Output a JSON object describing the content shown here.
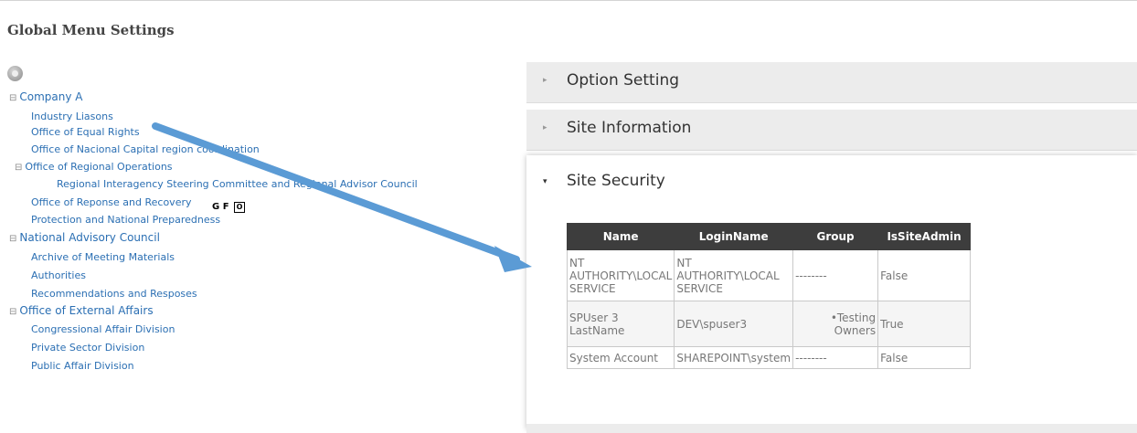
{
  "page": {
    "title": "Global Menu Settings"
  },
  "tree": {
    "icon": "gear-icon",
    "nodes": [
      {
        "label": "Company A",
        "toggle": "⊟",
        "level": 0
      },
      {
        "label": "Industry Liasons",
        "level": 1
      },
      {
        "label": "Office of Equal Rights",
        "level": 1
      },
      {
        "label": "Office of Nacional Capital region coordination",
        "level": 1
      },
      {
        "label": "Office of Regional Operations",
        "toggle": "⊟",
        "level": 1
      },
      {
        "label": "Regional Interagency Steering Committee and Regional Advisor Council",
        "level": 2
      },
      {
        "label": "Office of Reponse and Recovery",
        "level": 1
      },
      {
        "label": "Protection and National Preparedness",
        "level": 1
      },
      {
        "label": "National Advisory Council",
        "toggle": "⊟",
        "level": 0
      },
      {
        "label": "Archive of Meeting Materials",
        "level": 1
      },
      {
        "label": "Authorities",
        "level": 1
      },
      {
        "label": "Recommendations and Resposes",
        "level": 1
      },
      {
        "label": "Office of External Affairs",
        "toggle": "⊟",
        "level": 0
      },
      {
        "label": "Congressional Affair Division",
        "level": 1
      },
      {
        "label": "Private Sector Division",
        "level": 1
      },
      {
        "label": "Public Affair Division",
        "level": 1
      }
    ],
    "controls": {
      "g": "G",
      "f": "F",
      "o": "O"
    }
  },
  "accordion": {
    "option_setting": "Option Setting",
    "site_information": "Site Information",
    "site_security": "Site Security"
  },
  "security_table": {
    "headers": [
      "Name",
      "LoginName",
      "Group",
      "IsSiteAdmin"
    ],
    "rows": [
      {
        "name": "NT AUTHORITY\\LOCAL SERVICE",
        "login": "NT AUTHORITY\\LOCAL SERVICE",
        "group": "--------",
        "admin": "False"
      },
      {
        "name": "SPUser 3 LastName",
        "login": "DEV\\spuser3",
        "group": "Testing Owners",
        "admin": "True"
      },
      {
        "name": "System Account",
        "login": "SHAREPOINT\\system",
        "group": "--------",
        "admin": "False"
      }
    ]
  },
  "colors": {
    "link": "#2b6fb3",
    "arrow": "#5b9bd5",
    "table_header": "#3d3d3d"
  }
}
